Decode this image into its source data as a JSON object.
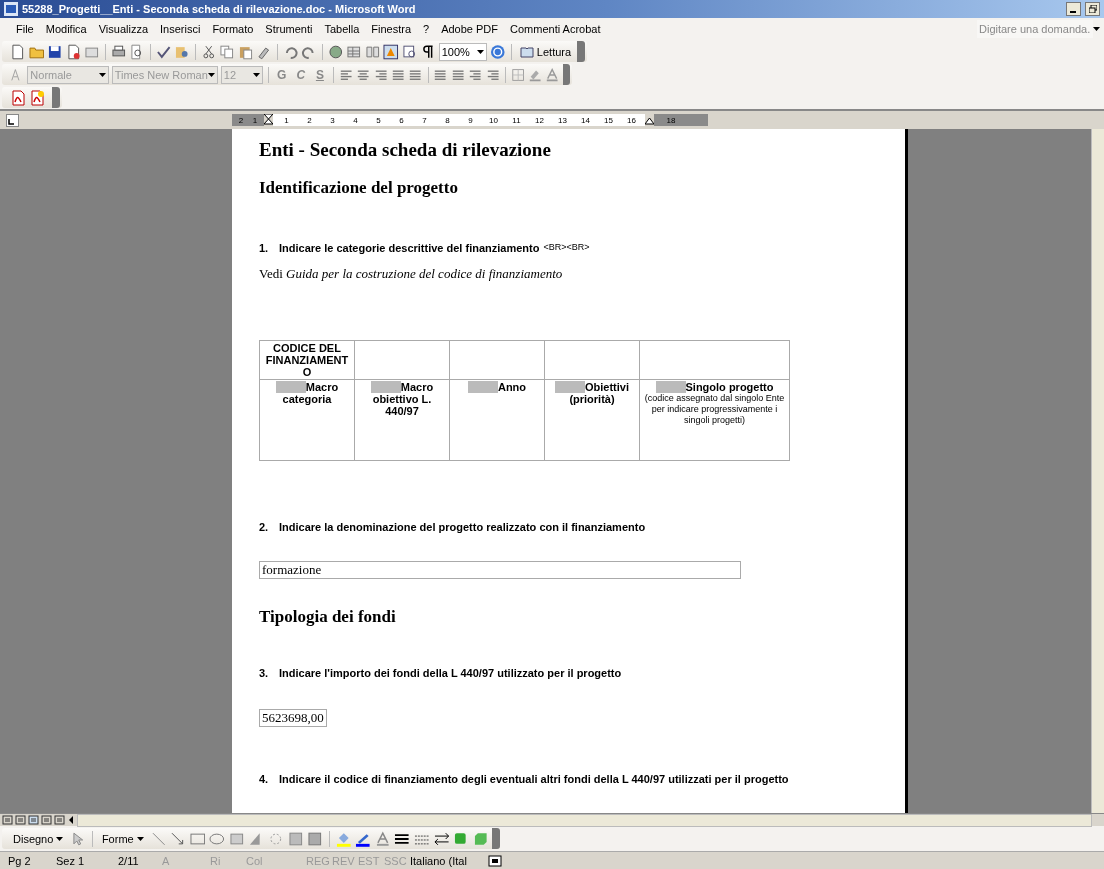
{
  "window": {
    "title": "55288_Progetti__Enti - Seconda scheda di rilevazione.doc - Microsoft Word"
  },
  "menu": [
    "File",
    "Modifica",
    "Visualizza",
    "Inserisci",
    "Formato",
    "Strumenti",
    "Tabella",
    "Finestra",
    "?",
    "Adobe PDF",
    "Commenti Acrobat"
  ],
  "help_field": {
    "placeholder": "Digitare una domanda."
  },
  "standard_toolbar": {
    "zoom": "100%",
    "reading_button": "Lettura"
  },
  "formatting_toolbar": {
    "style": "Normale",
    "font": "Times New Roman",
    "size": "12",
    "buttons": [
      "G",
      "C",
      "S"
    ]
  },
  "ruler": {
    "left_labels": [
      "2",
      "1"
    ],
    "labels": [
      "1",
      "2",
      "3",
      "4",
      "5",
      "6",
      "7",
      "8",
      "9",
      "10",
      "11",
      "12",
      "13",
      "14",
      "15",
      "16"
    ],
    "right_labels": [
      "18"
    ]
  },
  "document": {
    "title": "Enti - Seconda scheda di rilevazione",
    "sections": [
      {
        "kind": "heading",
        "text": "Identificazione del progetto"
      },
      {
        "kind": "question",
        "number": "1.",
        "text": "Indicare le categorie descrittive del finanziamento",
        "tag": "<BR><BR>"
      },
      {
        "kind": "note",
        "text": "Vedi *Guida per la costruzione del codice di finanziamento*"
      },
      {
        "kind": "table",
        "header": "CODICE DEL FINANZIAMENTO",
        "columns": [
          {
            "label": "Macro categoria"
          },
          {
            "label": "Macro obiettivo L. 440/97"
          },
          {
            "label": "Anno"
          },
          {
            "label": "Obiettivi (priorità)"
          },
          {
            "label": "Singolo progetto",
            "note": "(codice assegnato dal singolo Ente per indicare progressivamente i singoli progetti)"
          }
        ]
      },
      {
        "kind": "question",
        "number": "2.",
        "text": "Indicare la denominazione del progetto realizzato con il finanziamento"
      },
      {
        "kind": "field",
        "value": "formazione",
        "wide": true
      },
      {
        "kind": "heading",
        "text": "Tipologia dei fondi"
      },
      {
        "kind": "question",
        "number": "3.",
        "text": "Indicare l'importo dei fondi della L 440/97 utilizzato per il progetto"
      },
      {
        "kind": "field",
        "value": "5623698,00",
        "wide": false
      },
      {
        "kind": "question",
        "number": "4.",
        "text": "Indicare il codice di finanziamento degli eventuali altri fondi della L 440/97 utilizzati per il progetto"
      }
    ]
  },
  "drawing_toolbar": {
    "draw_menu": "Disegno",
    "shapes_menu": "Forme"
  },
  "status_bar": [
    {
      "text": "Pg 2",
      "disabled": false
    },
    {
      "text": "Sez 1",
      "disabled": false
    },
    {
      "text": "2/11",
      "disabled": false
    },
    {
      "text": "A",
      "disabled": true
    },
    {
      "text": "Ri",
      "disabled": true
    },
    {
      "text": "Col",
      "disabled": true
    },
    {
      "text": "REG",
      "disabled": true
    },
    {
      "text": "REV",
      "disabled": true
    },
    {
      "text": "EST",
      "disabled": true
    },
    {
      "text": "SSC",
      "disabled": true
    },
    {
      "text": "Italiano (Ital",
      "disabled": false
    }
  ]
}
